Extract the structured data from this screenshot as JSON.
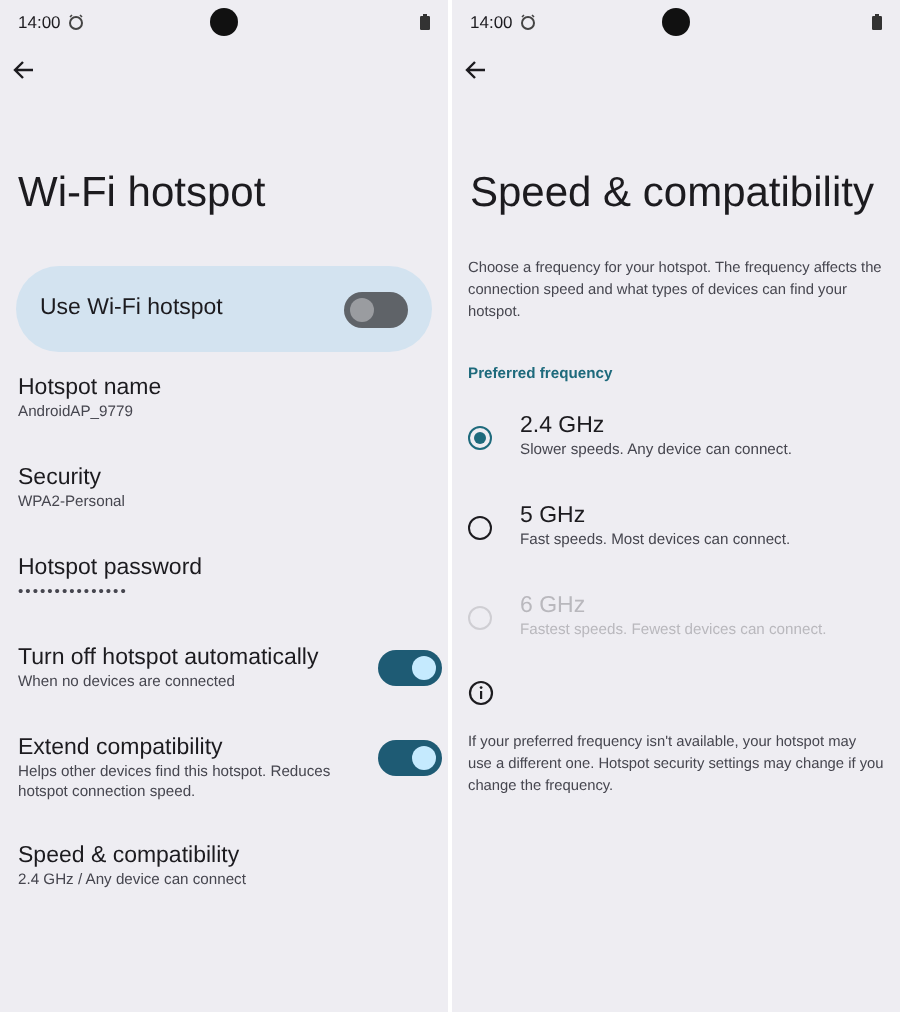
{
  "hotspot_screen": {
    "status_bar": {
      "time": "14:00"
    },
    "title": "Wi-Fi hotspot",
    "main_switch": {
      "label": "Use Wi-Fi hotspot",
      "on": false
    },
    "settings": [
      {
        "kind": "text",
        "title": "Hotspot name",
        "summary": "AndroidAP_9779"
      },
      {
        "kind": "text",
        "title": "Security",
        "summary": "WPA2-Personal"
      },
      {
        "kind": "password",
        "title": "Hotspot password",
        "summary": "•••••••••••••••"
      },
      {
        "kind": "switch",
        "title": "Turn off hotspot automatically",
        "summary": "When no devices are connected",
        "on": true
      },
      {
        "kind": "switch",
        "title": "Extend compatibility",
        "summary": "Helps other devices find this hotspot. Reduces hotspot connection speed.",
        "on": true
      },
      {
        "kind": "text",
        "title": "Speed & compatibility",
        "summary": "2.4 GHz / Any device can connect"
      }
    ]
  },
  "speed_screen": {
    "status_bar": {
      "time": "14:00"
    },
    "title": "Speed & compatibility",
    "description": "Choose a frequency for your hotspot. The frequency affects the connection speed and what types of devices can find your hotspot.",
    "section_header": "Preferred frequency",
    "options": [
      {
        "label": "2.4 GHz",
        "summary": "Slower speeds. Any device can connect.",
        "selected": true,
        "disabled": false
      },
      {
        "label": "5 GHz",
        "summary": "Fast speeds. Most devices can connect.",
        "selected": false,
        "disabled": false
      },
      {
        "label": "6 GHz",
        "summary": "Fastest speeds. Fewest devices can connect.",
        "selected": false,
        "disabled": true
      }
    ],
    "info_text": "If your preferred frequency isn't available, your hotspot may use a different one. Hotspot security settings may change if you change the frequency."
  }
}
